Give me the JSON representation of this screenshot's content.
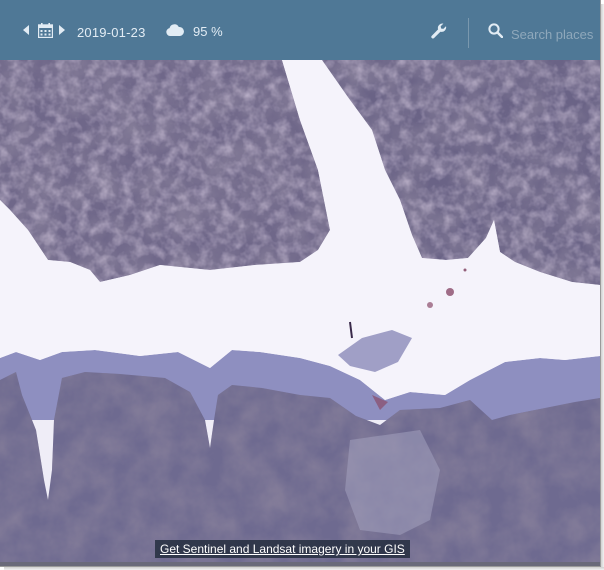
{
  "toolbar": {
    "prev_icon": "caret-left-icon",
    "calendar_icon": "calendar-icon",
    "next_icon": "caret-right-icon",
    "date": "2019-01-23",
    "cloud_icon": "cloud-icon",
    "cloud_coverage": "95 %",
    "settings_icon": "wrench-icon",
    "search_icon": "search-icon",
    "search_placeholder": "Search places",
    "background_color": "#4f7896"
  },
  "map": {
    "attribution_link": "Get Sentinel and Landsat imagery in your GIS"
  },
  "colors": {
    "snow": "#f3f1fa",
    "terrain": "#6f6789",
    "terrain_dark": "#403a56",
    "terrain_light": "#b8a9c8"
  }
}
